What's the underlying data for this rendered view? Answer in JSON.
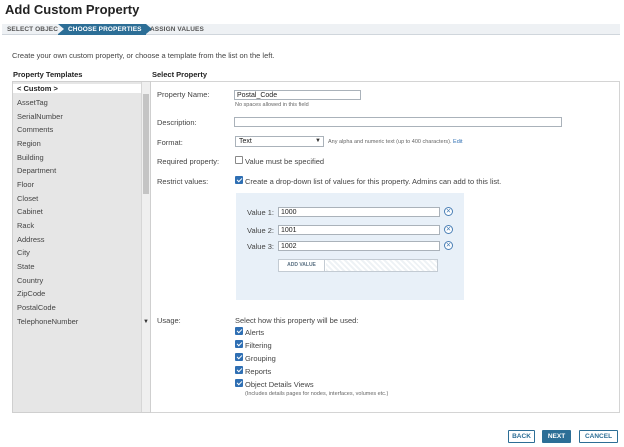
{
  "page": {
    "title": "Add Custom Property"
  },
  "steps": [
    "SELECT OBJECT",
    "CHOOSE PROPERTIES",
    "ASSIGN VALUES"
  ],
  "intro": "Create your own custom property, or choose a template from the list on the left.",
  "templates": {
    "heading": "Property Templates",
    "items": [
      "< Custom >",
      "AssetTag",
      "SerialNumber",
      "Comments",
      "Region",
      "Building",
      "Department",
      "Floor",
      "Closet",
      "Cabinet",
      "Rack",
      "Address",
      "City",
      "State",
      "Country",
      "ZipCode",
      "PostalCode",
      "TelephoneNumber"
    ],
    "selected_index": 0
  },
  "form": {
    "heading": "Select Property",
    "name_label": "Property Name:",
    "name_value": "Postal_Code",
    "name_hint": "No spaces allowed in this field",
    "desc_label": "Description:",
    "desc_value": "",
    "format_label": "Format:",
    "format_value": "Text",
    "format_hint": "Any alpha and numeric text (up to 400 characters).",
    "format_edit": "Edit",
    "required_label": "Required property:",
    "required_text": "Value must be specified",
    "required_checked": false,
    "restrict_label": "Restrict values:",
    "restrict_text": "Create a drop-down list of values for this property. Admins can add to this list.",
    "restrict_checked": true,
    "values": [
      {
        "label": "Value 1:",
        "value": "1000"
      },
      {
        "label": "Value 2:",
        "value": "1001"
      },
      {
        "label": "Value 3:",
        "value": "1002"
      }
    ],
    "add_value_label": "ADD VALUE",
    "usage_label": "Usage:",
    "usage_text": "Select how this property will be used:",
    "usage_options": [
      {
        "label": "Alerts",
        "checked": true
      },
      {
        "label": "Filtering",
        "checked": true
      },
      {
        "label": "Grouping",
        "checked": true
      },
      {
        "label": "Reports",
        "checked": true
      },
      {
        "label": "Object Details Views",
        "checked": true
      }
    ],
    "usage_hint": "(Includes details pages for nodes, interfaces, volumes etc.)"
  },
  "buttons": {
    "back": "BACK",
    "next": "NEXT",
    "cancel": "CANCEL"
  },
  "colors": {
    "accent": "#2c6e96",
    "checkbox": "#2f6fb3",
    "values_panel": "#e8f0f8"
  },
  "icons": {
    "remove": "close-circle-icon",
    "caret": "chevron-down-icon"
  }
}
